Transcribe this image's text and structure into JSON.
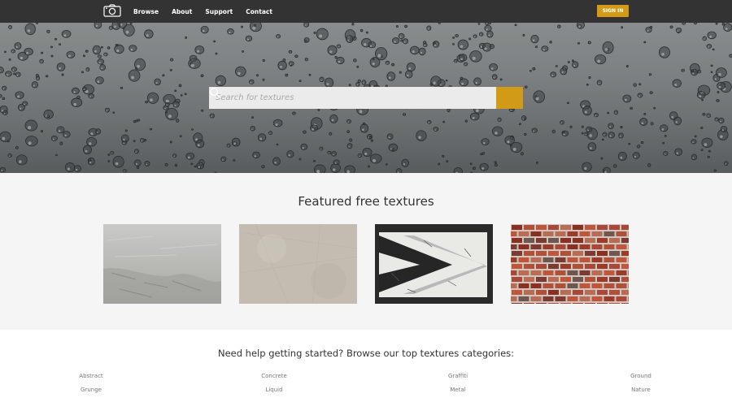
{
  "header": {
    "logo_icon": "camera-icon",
    "nav": [
      "Browse",
      "About",
      "Support",
      "Contact"
    ],
    "signin_label": "SIGN IN",
    "accent_color": "#d19b18",
    "bar_color": "#333333"
  },
  "hero": {
    "search_placeholder": "Search for textures",
    "search_icon": "search-icon"
  },
  "featured": {
    "title": "Featured free textures",
    "items": [
      {
        "name": "concrete-texture"
      },
      {
        "name": "paper-texture"
      },
      {
        "name": "arrow-texture"
      },
      {
        "name": "brick-texture"
      }
    ]
  },
  "categories": {
    "title": "Need help getting started? Browse our top textures categories:",
    "row1": [
      "Abstract",
      "Concrete",
      "Graffiti",
      "Ground"
    ],
    "row2": [
      "Grunge",
      "Liquid",
      "Metal",
      "Nature"
    ]
  }
}
